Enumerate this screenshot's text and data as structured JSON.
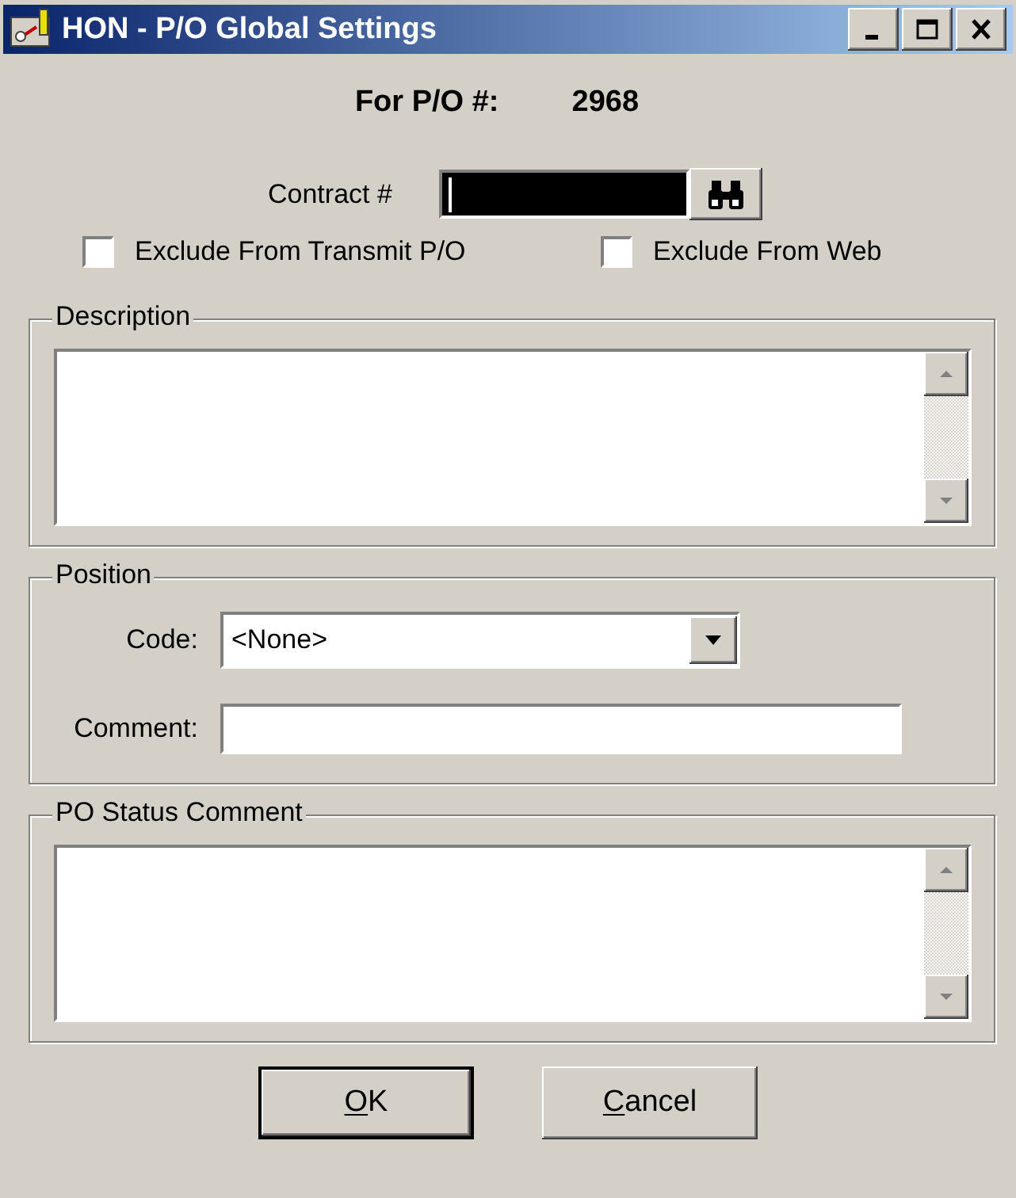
{
  "window": {
    "title": "HON - P/O Global Settings",
    "controls": [
      {
        "kind": "minimize"
      },
      {
        "kind": "maximize"
      },
      {
        "kind": "close"
      }
    ]
  },
  "po": {
    "label": "For P/O #:",
    "value": "2968"
  },
  "contract": {
    "label": "Contract #",
    "focused": true
  },
  "checkboxes": [
    {
      "label": "Exclude From Transmit P/O",
      "checked": false
    },
    {
      "label": "Exclude From Web",
      "checked": false
    }
  ],
  "description": {
    "legend": "Description"
  },
  "position": {
    "legend": "Position",
    "code_label": "Code:",
    "code_value": "<None>",
    "comment_label": "Comment:"
  },
  "status_comment": {
    "legend": "PO Status Comment"
  },
  "buttons": [
    {
      "label": "OK",
      "mnemonic": true,
      "default": true
    },
    {
      "label": "Cancel",
      "mnemonic": true,
      "default": false
    }
  ]
}
